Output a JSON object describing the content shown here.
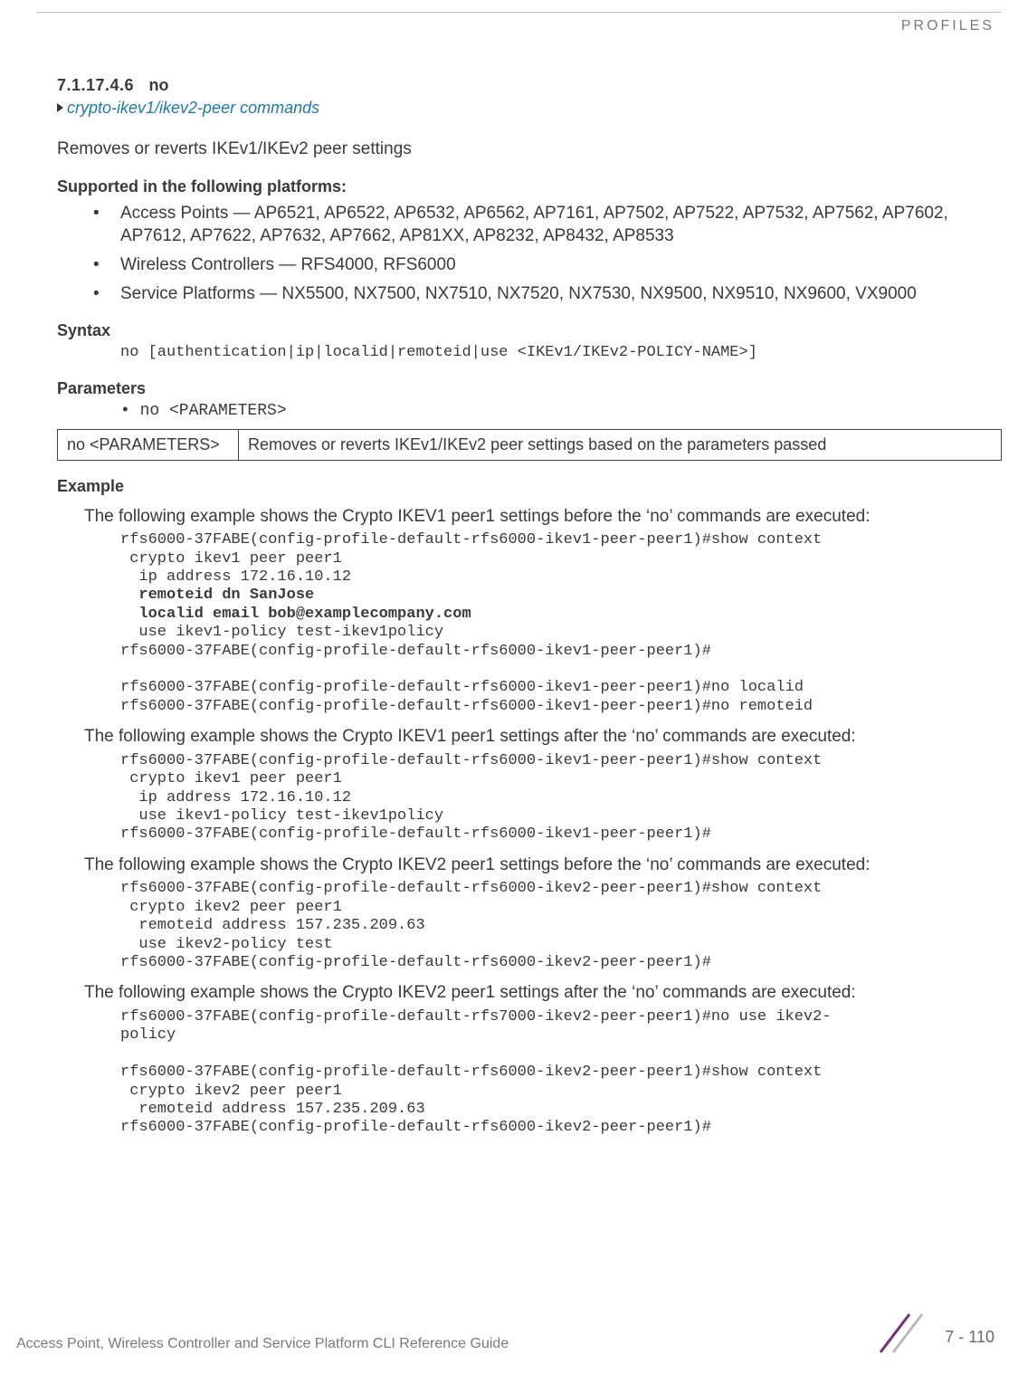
{
  "header": {
    "category": "PROFILES"
  },
  "section": {
    "number": "7.1.17.4.6",
    "title": "no"
  },
  "breadcrumb": {
    "text": "crypto-ikev1/ikev2-peer commands"
  },
  "intro": "Removes or reverts IKEv1/IKEv2 peer settings",
  "supported": {
    "heading": "Supported in the following platforms:",
    "items": [
      "Access Points — AP6521, AP6522, AP6532, AP6562, AP7161, AP7502, AP7522, AP7532, AP7562, AP7602, AP7612, AP7622, AP7632, AP7662, AP81XX, AP8232, AP8432, AP8533",
      "Wireless Controllers — RFS4000, RFS6000",
      "Service Platforms — NX5500, NX7500, NX7510, NX7520, NX7530, NX9500, NX9510, NX9600, VX9000"
    ]
  },
  "syntax": {
    "heading": "Syntax",
    "code": "no [authentication|ip|localid|remoteid|use <IKEv1/IKEv2-POLICY-NAME>]"
  },
  "parameters": {
    "heading": "Parameters",
    "line": "• no <PARAMETERS>",
    "table": {
      "c1": "no <PARAMETERS>",
      "c2": "Removes or reverts IKEv1/IKEv2 peer settings based on the parameters passed"
    }
  },
  "example": {
    "heading": "Example",
    "p1": "The following example shows the Crypto IKEV1 peer1 settings before the ‘no’ commands are executed:",
    "code1a": "rfs6000-37FABE(config-profile-default-rfs6000-ikev1-peer-peer1)#show context\n crypto ikev1 peer peer1\n  ip address 172.16.10.12",
    "code1b": "  remoteid dn SanJose\n  localid email bob@examplecompany.com",
    "code1c": "  use ikev1-policy test-ikev1policy\nrfs6000-37FABE(config-profile-default-rfs6000-ikev1-peer-peer1)#\n\nrfs6000-37FABE(config-profile-default-rfs6000-ikev1-peer-peer1)#no localid\nrfs6000-37FABE(config-profile-default-rfs6000-ikev1-peer-peer1)#no remoteid",
    "p2": "The following example shows the Crypto IKEV1 peer1 settings after the ‘no’ commands are executed:",
    "code2": "rfs6000-37FABE(config-profile-default-rfs6000-ikev1-peer-peer1)#show context\n crypto ikev1 peer peer1\n  ip address 172.16.10.12\n  use ikev1-policy test-ikev1policy\nrfs6000-37FABE(config-profile-default-rfs6000-ikev1-peer-peer1)#",
    "p3": "The following example shows the Crypto IKEV2 peer1 settings before the ‘no’ commands are executed:",
    "code3": "rfs6000-37FABE(config-profile-default-rfs6000-ikev2-peer-peer1)#show context\n crypto ikev2 peer peer1\n  remoteid address 157.235.209.63\n  use ikev2-policy test\nrfs6000-37FABE(config-profile-default-rfs6000-ikev2-peer-peer1)#",
    "p4": "The following example shows the Crypto IKEV2 peer1 settings after the ‘no’ commands are executed:",
    "code4": "rfs6000-37FABE(config-profile-default-rfs7000-ikev2-peer-peer1)#no use ikev2-\npolicy\n\nrfs6000-37FABE(config-profile-default-rfs6000-ikev2-peer-peer1)#show context\n crypto ikev2 peer peer1\n  remoteid address 157.235.209.63\nrfs6000-37FABE(config-profile-default-rfs6000-ikev2-peer-peer1)#"
  },
  "footer": {
    "text": "Access Point, Wireless Controller and Service Platform CLI Reference Guide",
    "page": "7 - 110"
  }
}
